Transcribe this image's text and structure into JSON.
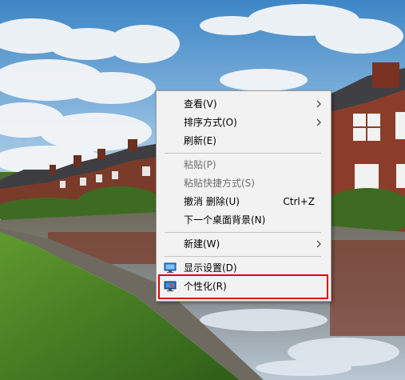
{
  "context_menu": {
    "items": [
      {
        "label": "查看(V)",
        "has_submenu": true
      },
      {
        "label": "排序方式(O)",
        "has_submenu": true
      },
      {
        "label": "刷新(E)"
      },
      {
        "label": "粘贴(P)",
        "disabled": true
      },
      {
        "label": "粘贴快捷方式(S)",
        "disabled": true
      },
      {
        "label": "撤消 删除(U)",
        "shortcut": "Ctrl+Z"
      },
      {
        "label": "下一个桌面背景(N)"
      },
      {
        "label": "新建(W)",
        "has_submenu": true
      },
      {
        "label": "显示设置(D)",
        "icon": "display-icon"
      },
      {
        "label": "个性化(R)",
        "icon": "personalize-icon",
        "highlighted": true
      }
    ]
  },
  "colors": {
    "highlight_border": "#e00000",
    "menu_background": "#f2f2f2",
    "disabled_text": "#6d6d6d"
  }
}
